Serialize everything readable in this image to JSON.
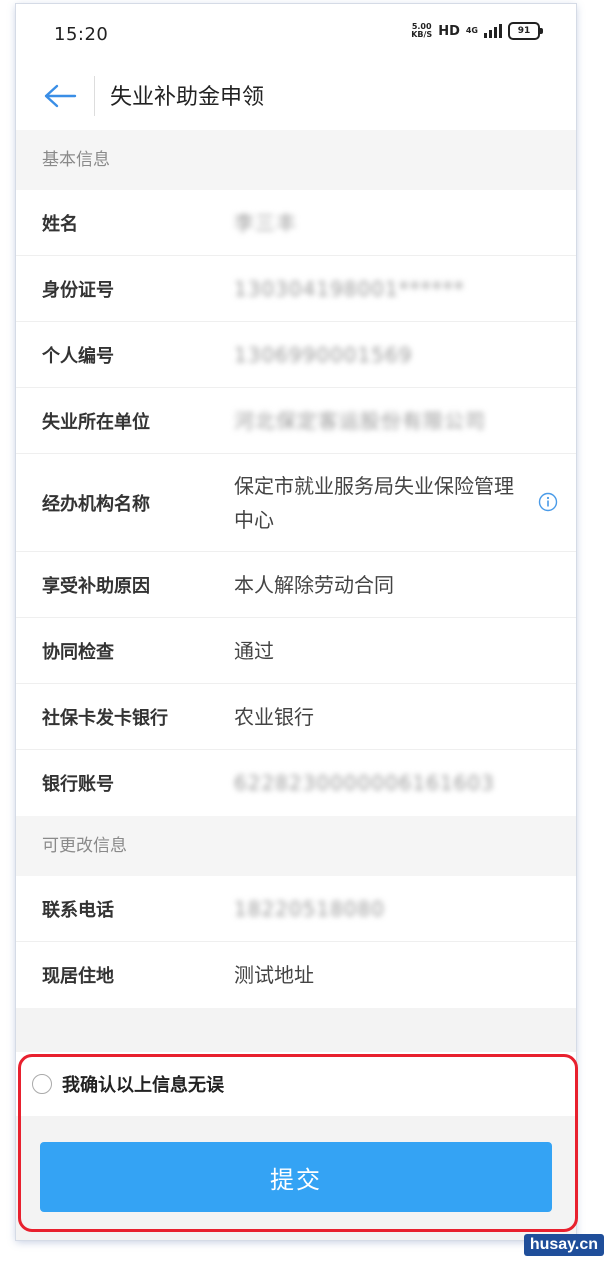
{
  "status_bar": {
    "time": "15:20",
    "net_speed_value": "5.00",
    "net_speed_unit": "KB/S",
    "hd_label": "HD",
    "network_label": "4G",
    "battery": "91"
  },
  "header": {
    "title": "失业补助金申领"
  },
  "basic_info": {
    "section_label": "基本信息",
    "rows": [
      {
        "label": "姓名",
        "value": "李三丰"
      },
      {
        "label": "身份证号",
        "value": "130304198001******"
      },
      {
        "label": "个人编号",
        "value": "1306990001569"
      },
      {
        "label": "失业所在单位",
        "value": "河北保定客运股份有限公司"
      },
      {
        "label": "经办机构名称",
        "value": "保定市就业服务局失业保险管理中心"
      },
      {
        "label": "享受补助原因",
        "value": "本人解除劳动合同"
      },
      {
        "label": "协同检查",
        "value": "通过"
      },
      {
        "label": "社保卡发卡银行",
        "value": "农业银行"
      },
      {
        "label": "银行账号",
        "value": "6228230000006161603"
      }
    ]
  },
  "editable_info": {
    "section_label": "可更改信息",
    "rows": [
      {
        "label": "联系电话",
        "value": "18220518080"
      },
      {
        "label": "现居住地",
        "value": "测试地址"
      }
    ]
  },
  "confirm": {
    "text": "我确认以上信息无误"
  },
  "submit": {
    "label": "提交"
  },
  "watermark": "husay.cn",
  "colors": {
    "accent": "#34a3f4",
    "back_arrow": "#3a8ee6",
    "highlight": "#e8202e"
  }
}
